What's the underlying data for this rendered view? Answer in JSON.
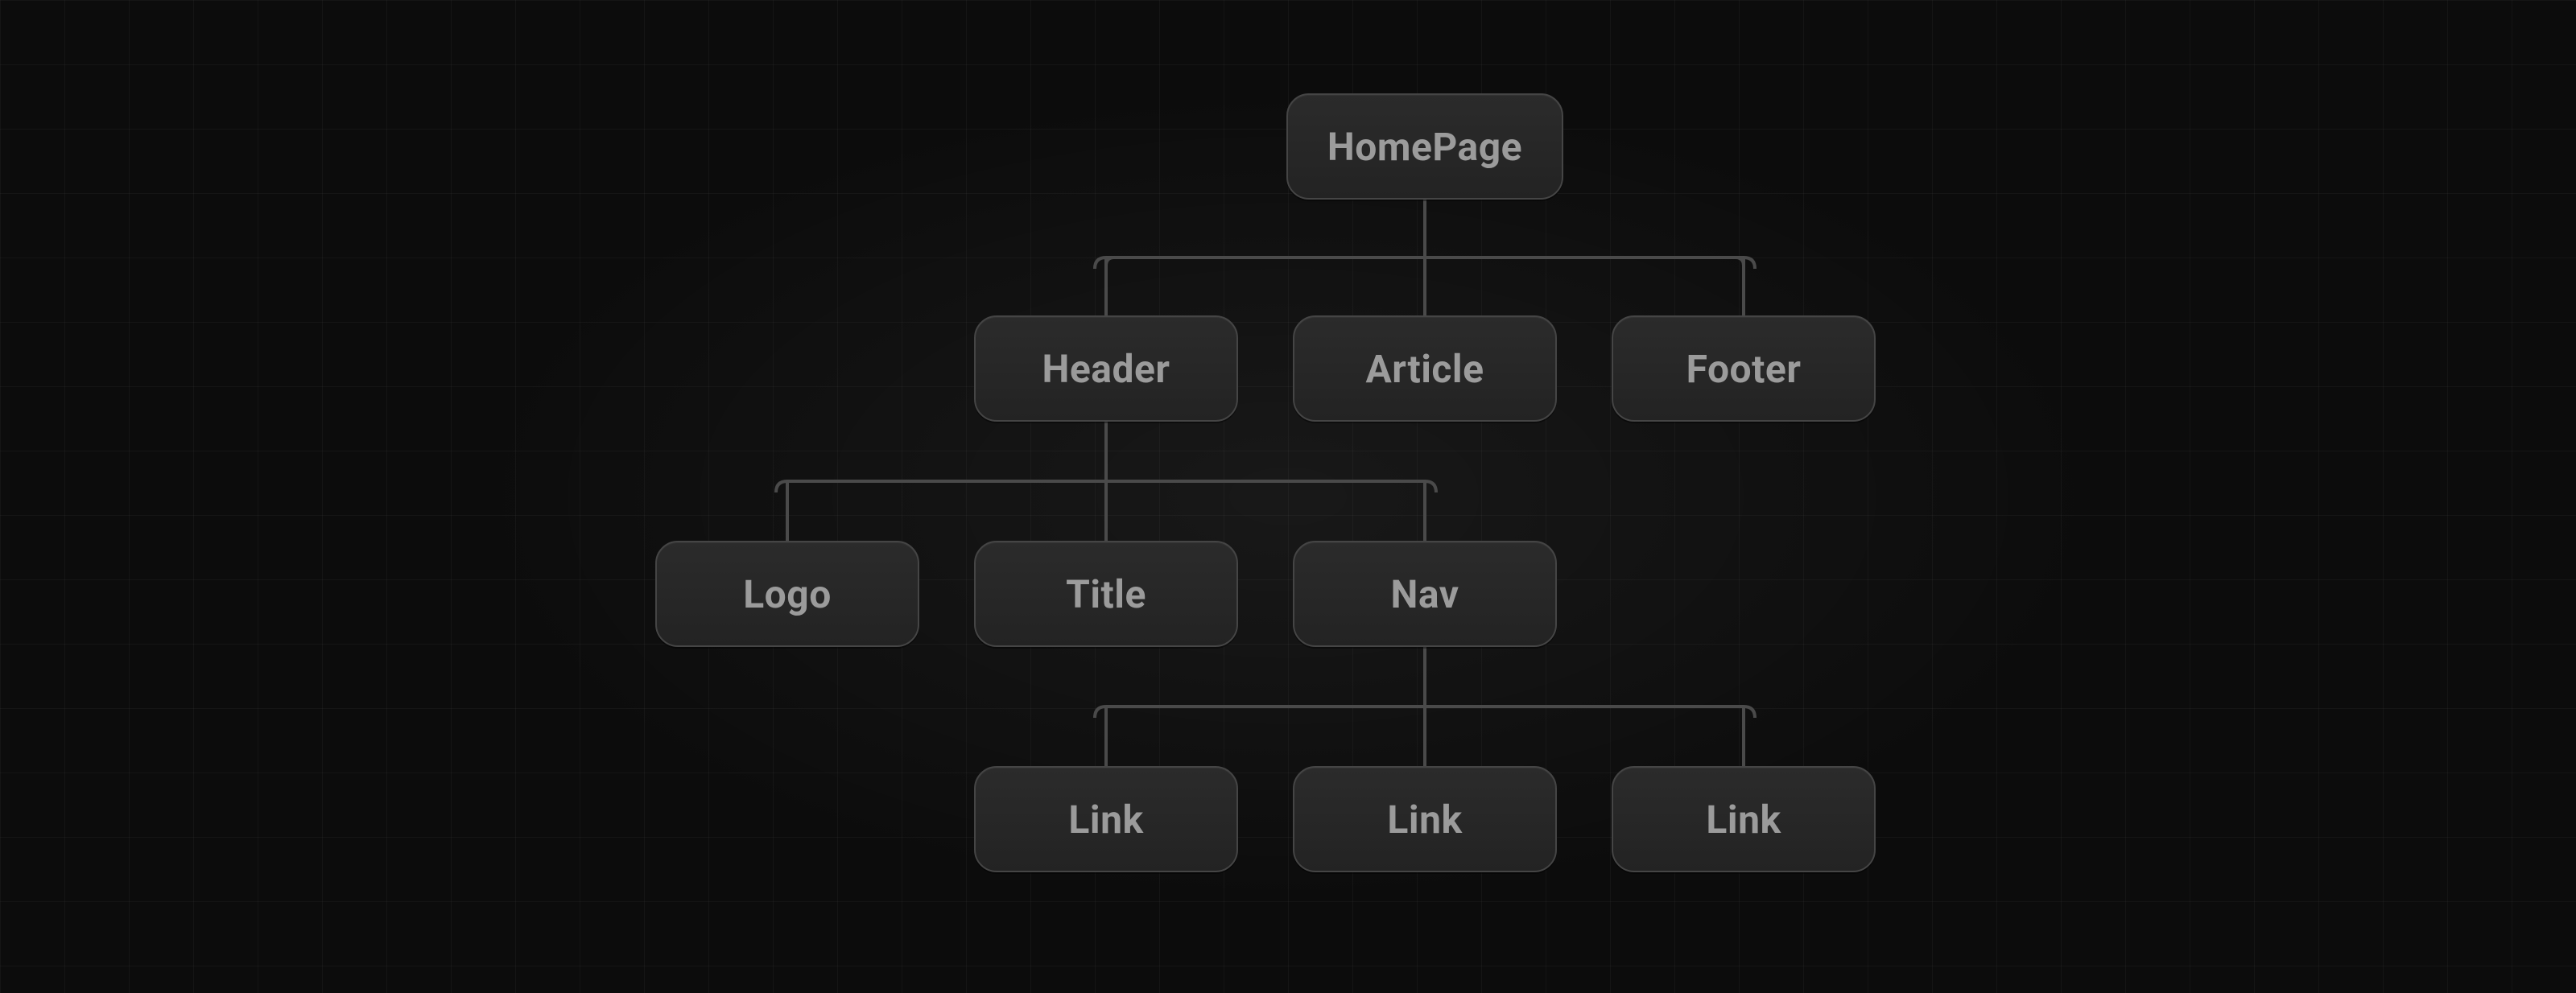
{
  "colors": {
    "background": "#0c0c0c",
    "node_fill_top": "#2b2b2b",
    "node_fill_bottom": "#232323",
    "node_border": "#454545",
    "node_text": "#9b9b9b",
    "connector": "#4a4a4a",
    "grid_line": "rgba(255,255,255,0.035)"
  },
  "tree": {
    "root": {
      "label": "HomePage",
      "children": [
        {
          "label": "Header",
          "children": [
            {
              "label": "Logo"
            },
            {
              "label": "Title"
            },
            {
              "label": "Nav",
              "children": [
                {
                  "label": "Link"
                },
                {
                  "label": "Link"
                },
                {
                  "label": "Link"
                }
              ]
            }
          ]
        },
        {
          "label": "Article"
        },
        {
          "label": "Footer"
        }
      ]
    }
  },
  "nodes": {
    "homepage": "HomePage",
    "header": "Header",
    "article": "Article",
    "footer": "Footer",
    "logo": "Logo",
    "title": "Title",
    "nav": "Nav",
    "link1": "Link",
    "link2": "Link",
    "link3": "Link"
  }
}
